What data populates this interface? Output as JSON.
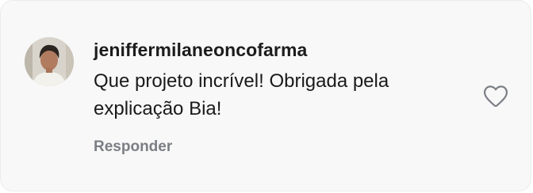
{
  "comment": {
    "username": "jeniffermilaneoncofarma",
    "text": "Que projeto incrível! Obrigada pela explicação Bia!",
    "reply_label": "Responder",
    "avatar_icon": "user-avatar",
    "like_icon": "heart-outline-icon"
  }
}
